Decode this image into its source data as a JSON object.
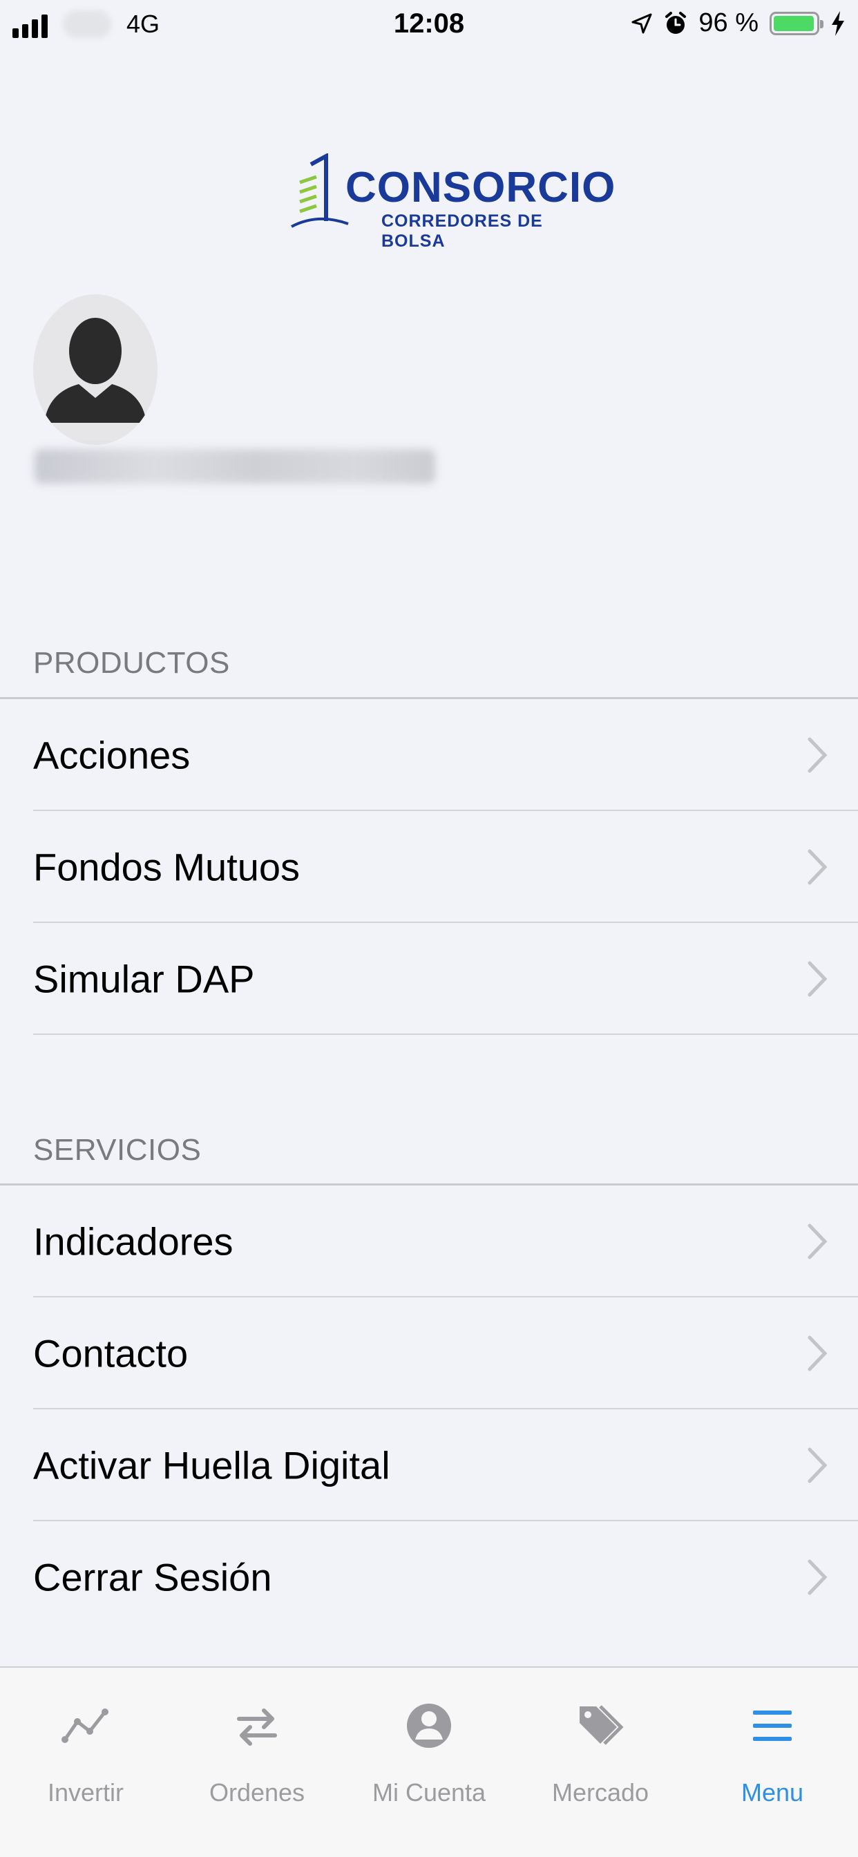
{
  "status_bar": {
    "network": "4G",
    "time": "12:08",
    "battery": "96 %",
    "battery_level": 0.96
  },
  "header": {
    "logo_title": "CONSORCIO",
    "logo_subtitle": "CORREDORES DE BOLSA"
  },
  "sections": [
    {
      "title": "PRODUCTOS",
      "items": [
        "Acciones",
        "Fondos Mutuos",
        "Simular DAP"
      ]
    },
    {
      "title": "SERVICIOS",
      "items": [
        "Indicadores",
        "Contacto",
        "Activar Huella Digital",
        "Cerrar Sesión"
      ]
    }
  ],
  "tab_bar": {
    "active": "menu",
    "tabs": [
      {
        "id": "invertir",
        "label": "Invertir",
        "icon": "chart-line-icon"
      },
      {
        "id": "ordenes",
        "label": "Ordenes",
        "icon": "swap-arrows-icon"
      },
      {
        "id": "mi_cuenta",
        "label": "Mi Cuenta",
        "icon": "user-circle-icon"
      },
      {
        "id": "mercado",
        "label": "Mercado",
        "icon": "tags-icon"
      },
      {
        "id": "menu",
        "label": "Menu",
        "icon": "hamburger-menu-icon"
      }
    ]
  },
  "colors": {
    "background": "#f1f3f8",
    "brand_blue": "#1a3a9a",
    "brand_green": "#8dc63f",
    "active_tab": "#2f8fe6",
    "inactive_tab": "#9b9ba0"
  }
}
